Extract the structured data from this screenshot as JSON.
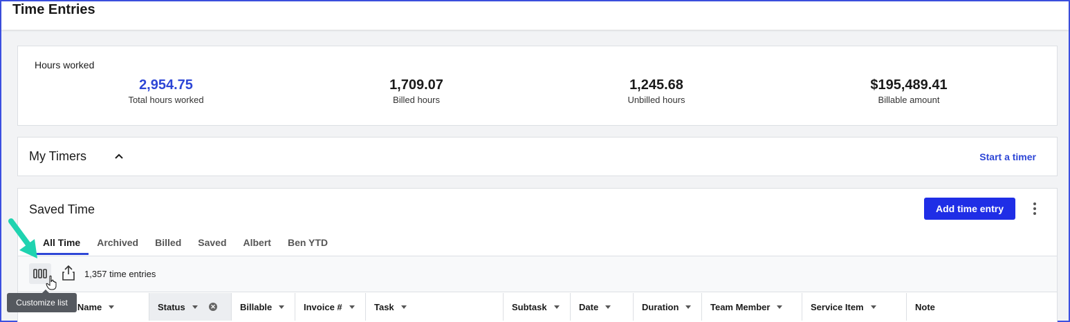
{
  "page": {
    "title": "Time Entries"
  },
  "hours": {
    "label": "Hours worked",
    "stats": [
      {
        "value": "2,954.75",
        "label": "Total hours worked"
      },
      {
        "value": "1,709.07",
        "label": "Billed hours"
      },
      {
        "value": "1,245.68",
        "label": "Unbilled hours"
      },
      {
        "value": "$195,489.41",
        "label": "Billable amount"
      }
    ]
  },
  "timers": {
    "title": "My Timers",
    "start_label": "Start a timer"
  },
  "saved": {
    "title": "Saved Time",
    "add_label": "Add time entry",
    "tabs": [
      "All Time",
      "Archived",
      "Billed",
      "Saved",
      "Albert",
      "Ben YTD"
    ],
    "active_tab": "All Time",
    "entry_count": "1,357 time entries",
    "tooltip": "Customize list",
    "columns": [
      {
        "label": "nt Name"
      },
      {
        "label": "Status"
      },
      {
        "label": "Billable"
      },
      {
        "label": "Invoice #"
      },
      {
        "label": "Task"
      },
      {
        "label": "Subtask"
      },
      {
        "label": "Date"
      },
      {
        "label": "Duration"
      },
      {
        "label": "Team Member"
      },
      {
        "label": "Service Item"
      },
      {
        "label": "Note"
      }
    ]
  },
  "colors": {
    "accent": "#2d46d6",
    "button": "#1f2ee6",
    "annotation": "#1fd3b0"
  },
  "icons": [
    "chevron-up-icon",
    "kebab-menu-icon",
    "columns-icon",
    "share-icon",
    "caret-down-icon",
    "clear-filter-icon",
    "annotation-arrow-icon",
    "hand-cursor-icon"
  ]
}
